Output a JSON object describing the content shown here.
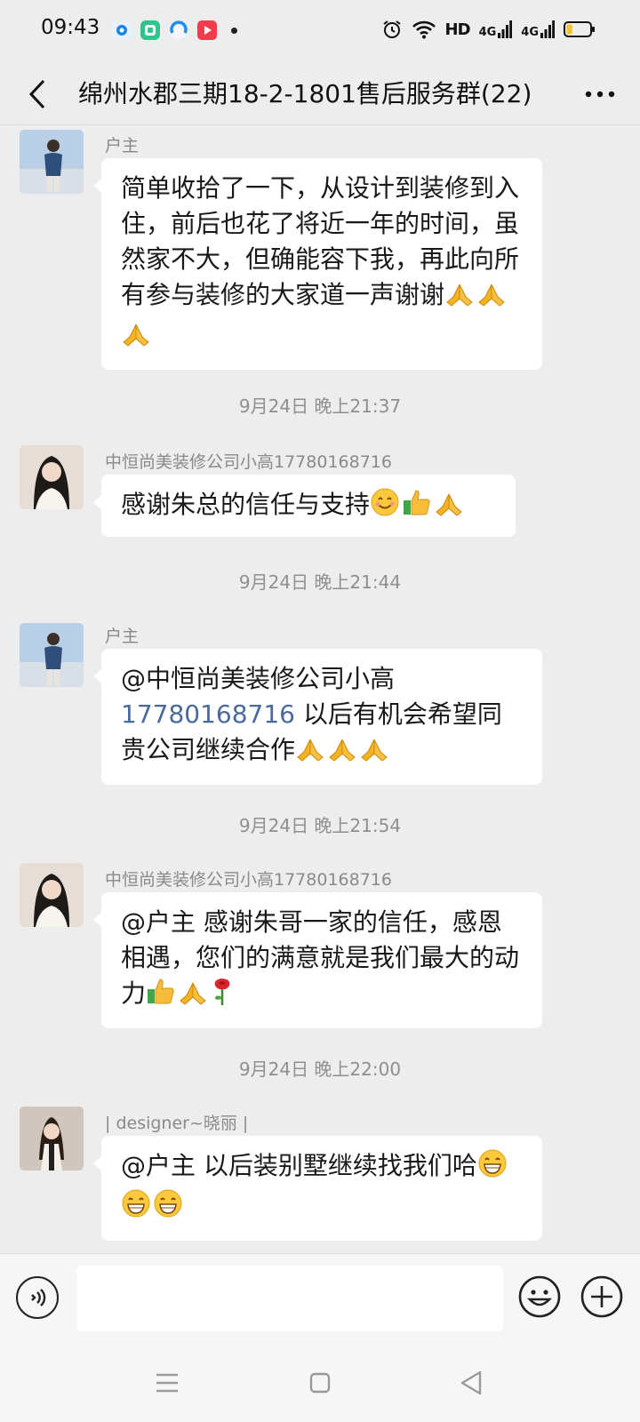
{
  "status_bar": {
    "time": "09:43",
    "app_icons": [
      "circle-app-icon",
      "square-app-icon",
      "chrome-like-icon",
      "video-app-icon"
    ],
    "hd_label": "HD",
    "signal_label_1": "4G",
    "signal_label_2": "4G",
    "battery_level": 0.25
  },
  "header": {
    "title": "绵州水郡三期18-2-1801售后服务群(22)"
  },
  "messages": [
    {
      "sender": "户主",
      "text": "简单收拾了一下，从设计到装修到入住，前后也花了将近一年的时间，虽然家不大，但确能容下我，再此向所有参与装修的大家道一声谢谢",
      "emojis": [
        "pray",
        "pray",
        "pray"
      ]
    },
    {
      "timestamp": "9月24日 晚上21:37"
    },
    {
      "sender": "中恒尚美装修公司小高17780168716",
      "text": "感谢朱总的信任与支持",
      "emojis": [
        "smile",
        "thumbs-up",
        "pray"
      ]
    },
    {
      "timestamp": "9月24日 晚上21:44"
    },
    {
      "sender": "户主",
      "text_prefix": "@中恒尚美装修公司小高",
      "mention_number": "17780168716",
      "text": " 以后有机会希望同贵公司继续合作",
      "emojis": [
        "pray",
        "pray",
        "pray"
      ]
    },
    {
      "timestamp": "9月24日 晚上21:54"
    },
    {
      "sender": "中恒尚美装修公司小高17780168716",
      "text": "@户主  感谢朱哥一家的信任，感恩相遇，您们的满意就是我们最大的动力",
      "emojis": [
        "thumbs-up",
        "pray",
        "rose"
      ]
    },
    {
      "timestamp": "9月24日 晚上22:00"
    },
    {
      "sender": "| designer~晓丽 |",
      "text": "@户主  以后装别墅继续找我们哈",
      "emojis": [
        "grin",
        "grin",
        "grin"
      ]
    }
  ],
  "input": {
    "value": "",
    "placeholder": ""
  },
  "nav": {
    "icons": [
      "menu-icon",
      "home-square-icon",
      "back-triangle-icon"
    ]
  }
}
